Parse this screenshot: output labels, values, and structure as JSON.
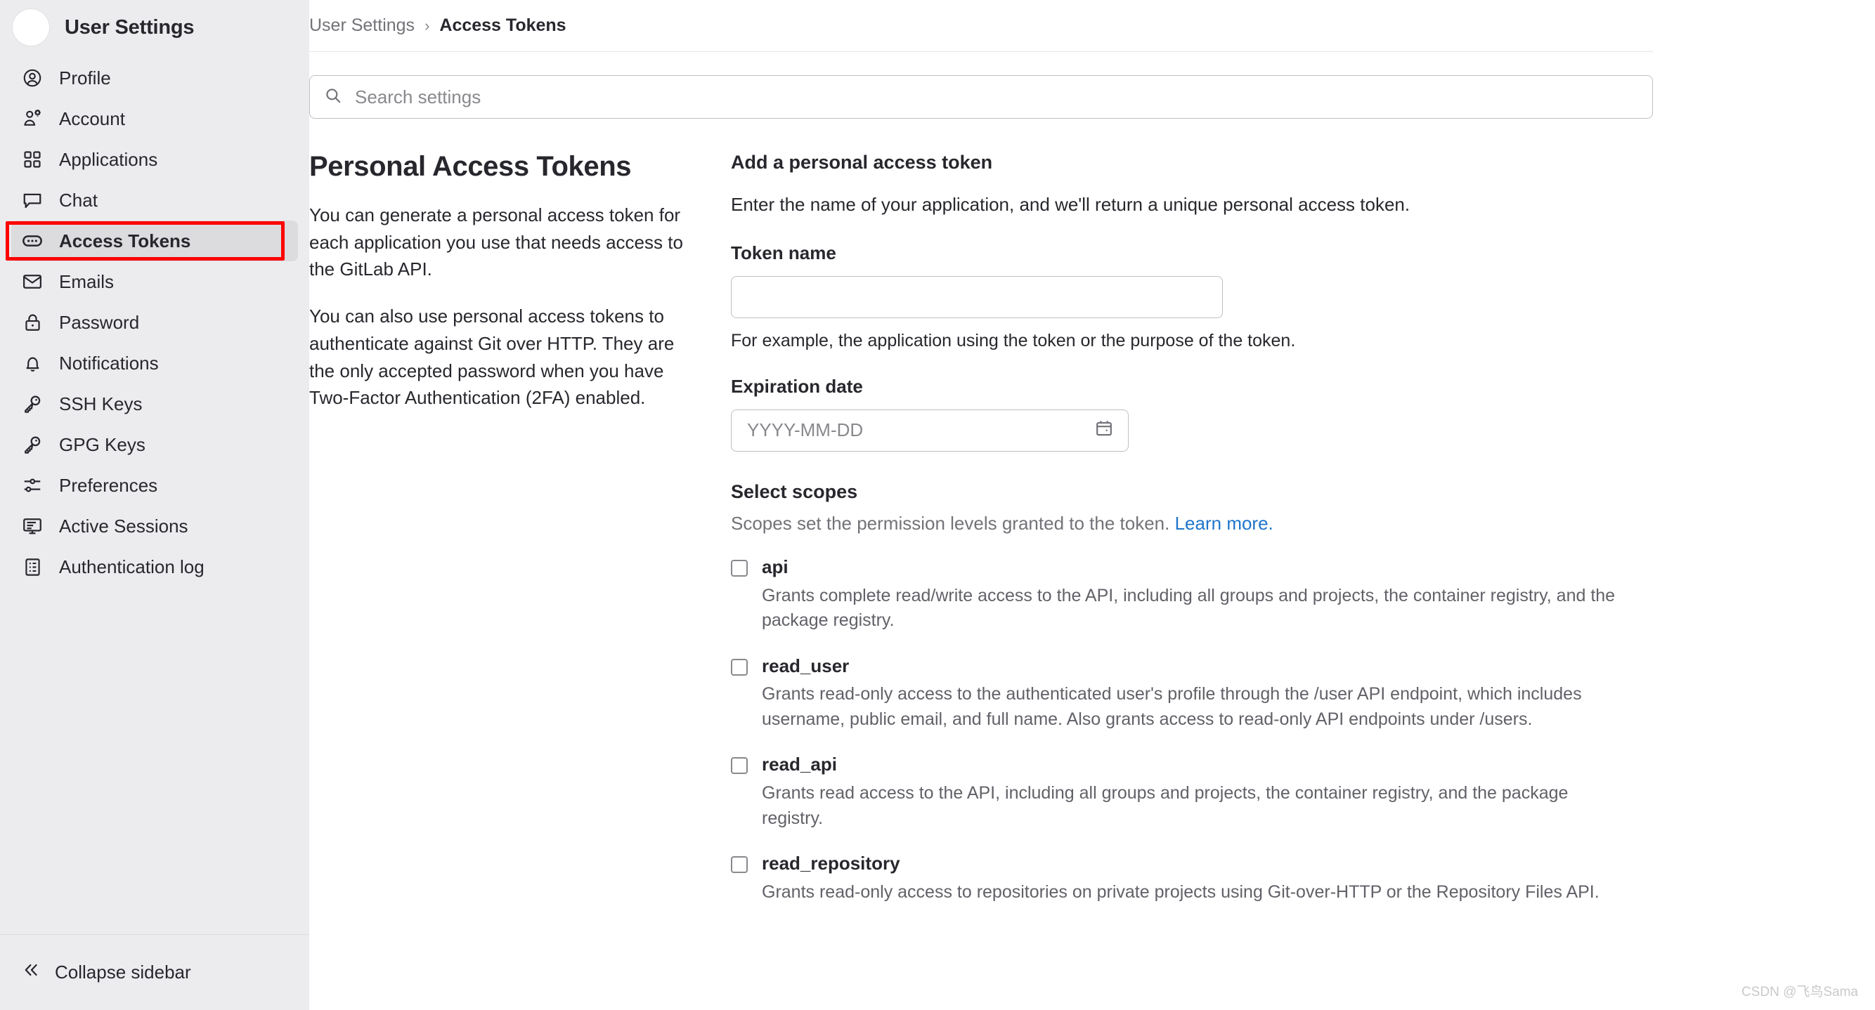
{
  "sidebar": {
    "title": "User Settings",
    "items": [
      {
        "label": "Profile",
        "icon": "user-circle-icon",
        "active": false
      },
      {
        "label": "Account",
        "icon": "user-gear-icon",
        "active": false
      },
      {
        "label": "Applications",
        "icon": "grid-apps-icon",
        "active": false
      },
      {
        "label": "Chat",
        "icon": "chat-bubble-icon",
        "active": false
      },
      {
        "label": "Access Tokens",
        "icon": "token-ellipsis-icon",
        "active": true
      },
      {
        "label": "Emails",
        "icon": "envelope-icon",
        "active": false
      },
      {
        "label": "Password",
        "icon": "lock-icon",
        "active": false
      },
      {
        "label": "Notifications",
        "icon": "bell-icon",
        "active": false
      },
      {
        "label": "SSH Keys",
        "icon": "key-icon",
        "active": false
      },
      {
        "label": "GPG Keys",
        "icon": "key-icon",
        "active": false
      },
      {
        "label": "Preferences",
        "icon": "sliders-icon",
        "active": false
      },
      {
        "label": "Active Sessions",
        "icon": "monitor-icon",
        "active": false
      },
      {
        "label": "Authentication log",
        "icon": "list-doc-icon",
        "active": false
      }
    ],
    "collapse_label": "Collapse sidebar",
    "collapse_icon": "chevron-double-left-icon",
    "highlight_color": "#fe0000",
    "background": "#ececef",
    "active_background": "#dcdcdf"
  },
  "breadcrumb": {
    "parent": "User Settings",
    "separator": "›",
    "current": "Access Tokens"
  },
  "search": {
    "placeholder": "Search settings",
    "icon": "search-icon"
  },
  "intro": {
    "title": "Personal Access Tokens",
    "paragraph_1": "You can generate a personal access token for each application you use that needs access to the GitLab API.",
    "paragraph_2": "You can also use personal access tokens to authenticate against Git over HTTP. They are the only accepted password when you have Two-Factor Authentication (2FA) enabled."
  },
  "form": {
    "title": "Add a personal access token",
    "lead": "Enter the name of your application, and we'll return a unique personal access token.",
    "token_name_label": "Token name",
    "token_name_value": "",
    "token_name_help": "For example, the application using the token or the purpose of the token.",
    "expiration_label": "Expiration date",
    "expiration_placeholder": "YYYY-MM-DD",
    "expiration_value": "",
    "calendar_icon": "calendar-icon",
    "scopes_title": "Select scopes",
    "scopes_subtitle": "Scopes set the permission levels granted to the token.",
    "scopes_link": "Learn more.",
    "link_color": "#1f75cb",
    "scopes": [
      {
        "name": "api",
        "checked": false,
        "description": "Grants complete read/write access to the API, including all groups and projects, the container registry, and the package registry."
      },
      {
        "name": "read_user",
        "checked": false,
        "description": "Grants read-only access to the authenticated user's profile through the /user API endpoint, which includes username, public email, and full name. Also grants access to read-only API endpoints under /users."
      },
      {
        "name": "read_api",
        "checked": false,
        "description": "Grants read access to the API, including all groups and projects, the container registry, and the package registry."
      },
      {
        "name": "read_repository",
        "checked": false,
        "description": "Grants read-only access to repositories on private projects using Git-over-HTTP or the Repository Files API."
      }
    ]
  },
  "watermark": "CSDN @飞鸟Sama"
}
